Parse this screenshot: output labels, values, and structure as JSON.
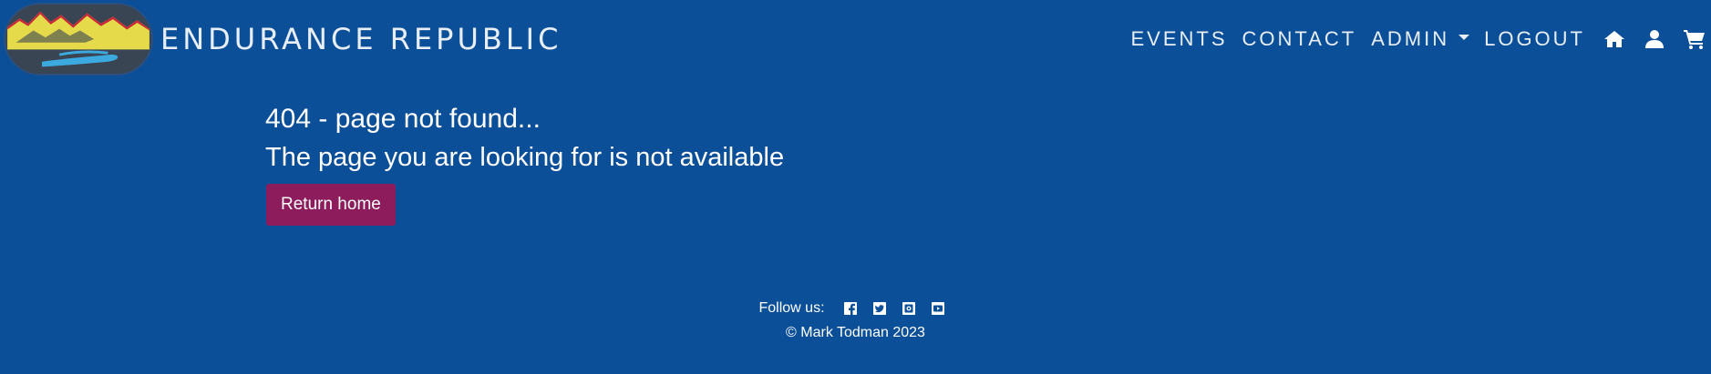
{
  "header": {
    "brand_name": "ENDURANCE REPUBLIC",
    "logo_icon": "mountain-river-logo",
    "nav": [
      {
        "label": "EVENTS"
      },
      {
        "label": "CONTACT"
      },
      {
        "label": "ADMIN",
        "dropdown": true
      },
      {
        "label": "LOGOUT"
      }
    ],
    "icons": [
      "home-icon",
      "user-icon",
      "cart-icon"
    ]
  },
  "main": {
    "title": "404 - page not found...",
    "subtitle": "The page you are looking for is not available",
    "return_button": "Return home"
  },
  "footer": {
    "follow_label": "Follow us:",
    "social_icons": [
      "facebook-icon",
      "twitter-icon",
      "instagram-icon",
      "youtube-icon"
    ],
    "copyright": "© Mark Todman 2023"
  },
  "colors": {
    "background": "#0b4f98",
    "button": "#8c1c5c",
    "text": "#ffffff"
  }
}
